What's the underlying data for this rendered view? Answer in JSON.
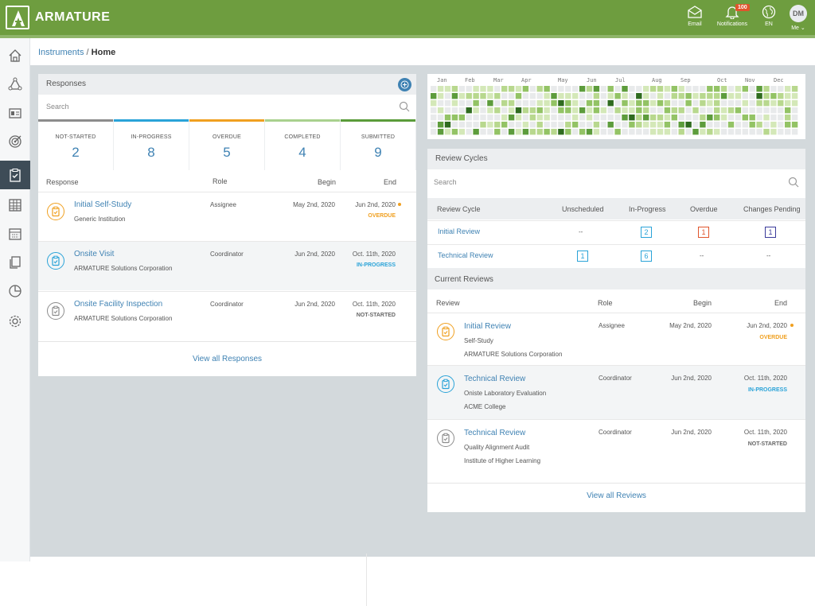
{
  "app": {
    "brand": "ARMATURE",
    "logo_letter": "A"
  },
  "topbar": {
    "email_label": "Email",
    "notifications_label": "Notifications",
    "notifications_count": "100",
    "language_label": "EN",
    "me_label": "Me",
    "avatar_initials": "DM"
  },
  "breadcrumb": {
    "parent": "Instruments",
    "separator": "/",
    "current": "Home"
  },
  "responses": {
    "title": "Responses",
    "search_placeholder": "Search",
    "stats": [
      {
        "label": "NOT-STARTED",
        "value": "2",
        "color": "#8c8c8c"
      },
      {
        "label": "IN-PROGRESS",
        "value": "8",
        "color": "#2aa3d8"
      },
      {
        "label": "OVERDUE",
        "value": "5",
        "color": "#f0a020"
      },
      {
        "label": "COMPLETED",
        "value": "4",
        "color": "#a9d18e"
      },
      {
        "label": "SUBMITTED",
        "value": "9",
        "color": "#5a9c3a"
      }
    ],
    "columns": {
      "response": "Response",
      "role": "Role",
      "begin": "Begin",
      "end": "End"
    },
    "rows": [
      {
        "title": "Initial Self-Study",
        "subtitle": "Generic  Institution",
        "role": "Assignee",
        "begin": "May 2nd, 2020",
        "end": "Jun 2nd, 2020",
        "status": "OVERDUE",
        "status_color": "#f0a020"
      },
      {
        "title": "Onsite Visit",
        "subtitle": "ARMATURE Solutions Corporation",
        "role": "Coordinator",
        "begin": "Jun 2nd, 2020",
        "end": "Oct. 11th, 2020",
        "status": "IN-PROGRESS",
        "status_color": "#2aa3d8"
      },
      {
        "title": "Onsite Facility Inspection",
        "subtitle": "ARMATURE Solutions Corporation",
        "role": "Coordinator",
        "begin": "Jun 2nd, 2020",
        "end": "Oct. 11th, 2020",
        "status": "NOT-STARTED",
        "status_color": "#666666"
      }
    ],
    "view_all": "View all Responses"
  },
  "heatmap": {
    "months": [
      "Jan",
      "Feb",
      "Mar",
      "Apr",
      "May",
      "Jun",
      "Jul",
      "Aug",
      "Sep",
      "Oct",
      "Nov",
      "Dec"
    ]
  },
  "review_cycles": {
    "title": "Review Cycles",
    "search_placeholder": "Search",
    "columns": {
      "cycle": "Review Cycle",
      "unscheduled": "Unscheduled",
      "in_progress": "In-Progress",
      "overdue": "Overdue",
      "changes": "Changes Pending"
    },
    "rows": [
      {
        "name": "Initial Review",
        "unscheduled": "--",
        "in_progress": "2",
        "overdue": "1",
        "changes": "1"
      },
      {
        "name": "Technical Review",
        "unscheduled": "1",
        "in_progress": "6",
        "overdue": "--",
        "changes": "--"
      }
    ]
  },
  "current_reviews": {
    "title": "Current Reviews",
    "columns": {
      "review": "Review",
      "role": "Role",
      "begin": "Begin",
      "end": "End"
    },
    "rows": [
      {
        "title": "Initial Review",
        "line1": "Self-Study",
        "line2": "ARMATURE Solutions Corporation",
        "role": "Assignee",
        "begin": "May 2nd, 2020",
        "end": "Jun 2nd, 2020",
        "status": "OVERDUE",
        "status_color": "#f0a020"
      },
      {
        "title": "Technical Review",
        "line1": "Oniste Laboratory Evaluation",
        "line2": "ACME College",
        "role": "Coordinator",
        "begin": "Jun 2nd, 2020",
        "end": "Oct. 11th, 2020",
        "status": "IN-PROGRESS",
        "status_color": "#2aa3d8"
      },
      {
        "title": "Technical Review",
        "line1": "Quality Alignment Audit",
        "line2": "Institute of Higher Learning",
        "role": "Coordinator",
        "begin": "Jun 2nd, 2020",
        "end": "Oct. 11th, 2020",
        "status": "NOT-STARTED",
        "status_color": "#666666"
      }
    ],
    "view_all": "View all Reviews"
  },
  "colors": {
    "brand_green": "#6e9d3f",
    "link_blue": "#3f82b3",
    "overdue_orange": "#f0a020",
    "inprogress_blue": "#2aa3d8",
    "notstarted_gray": "#8c8c8c"
  }
}
